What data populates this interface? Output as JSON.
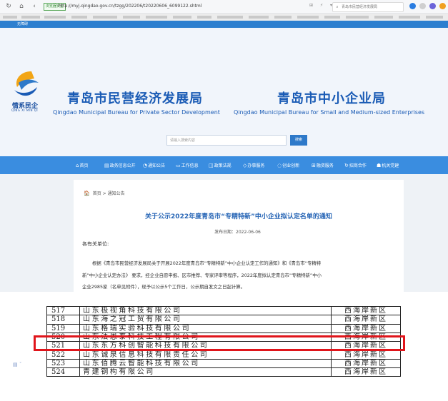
{
  "browser": {
    "security_tag": "浏览器安全",
    "url": "http://myj.qingdao.gov.cn/tzgg/202206/t20220606_6099122.shtml",
    "search_placeholder": "青岛市民营经济发展局"
  },
  "site": {
    "top_link": "无障碍",
    "logo_text": "情系民企",
    "logo_sub": "QING XI MIN QI",
    "title_left_cn": "青岛市民营经济发展局",
    "title_left_en": "Qingdao Municipal Bureau for Private Sector Development",
    "title_right_cn": "青岛市中小企业局",
    "title_right_en": "Qingdao Municipal Bureau for Small and Medium-sized Enterprises",
    "search_placeholder": "请输入搜索内容",
    "search_button": "搜索",
    "nav": [
      {
        "icon": "home-icon",
        "glyph": "⌂",
        "label": "首页"
      },
      {
        "icon": "document-icon",
        "glyph": "▤",
        "label": "政务信息公开"
      },
      {
        "icon": "notice-icon",
        "glyph": "◔",
        "label": "通知公告"
      },
      {
        "icon": "briefcase-icon",
        "glyph": "▭",
        "label": "工作信息"
      },
      {
        "icon": "law-icon",
        "glyph": "◫",
        "label": "政策法规"
      },
      {
        "icon": "service-icon",
        "glyph": "◇",
        "label": "办事服务"
      },
      {
        "icon": "innovation-icon",
        "glyph": "◌",
        "label": "创业创新"
      },
      {
        "icon": "finance-icon",
        "glyph": "⊞",
        "label": "融资服务"
      },
      {
        "icon": "cooperation-icon",
        "glyph": "↻",
        "label": "招商合作"
      },
      {
        "icon": "party-icon",
        "glyph": "☗",
        "label": "机关党建"
      }
    ]
  },
  "article": {
    "breadcrumb_home": "首页",
    "breadcrumb_sep": ">",
    "breadcrumb_current": "通知公告",
    "title": "关于公示2022年度青岛市“专精特新”中小企业拟认定名单的通知",
    "pub_date": "发布日期：2022-06-06",
    "salutation": "各有关单位:",
    "para_lines": [
      "根据《青岛市民营经济发展局关于开展2022年度青岛市“专精特新”中小企业认定工作的通知》和《青岛市“专精特",
      "新”中小企业认定办法》 要求，经企业自愿申报、区市推荐、专家评审等程序，2022年度拟认定青岛市“专精特新”中小",
      "企业2985家（名单见附件），现予以公示5个工作日，公示期自发文之日起计算。"
    ]
  },
  "table_rows": [
    {
      "num": "517",
      "name": "山东极视角科技有限公司",
      "district": "西海岸新区"
    },
    {
      "num": "518",
      "name": "山东海之冠工贸有限公司",
      "district": "西海岸新区"
    },
    {
      "num": "519",
      "name": "山东格瑞实验科技有限公司",
      "district": "西海岸新区"
    },
    {
      "num": "520",
      "name": "山东法恩泰科技工程有限公司",
      "district": "西海岸新区"
    },
    {
      "num": "521",
      "name": "山东东方科创智能科技有限公司",
      "district": "西海岸新区"
    },
    {
      "num": "522",
      "name": "山东诚泉信息科技有限责任公司",
      "district": "西海岸新区"
    },
    {
      "num": "523",
      "name": "山东佰腾云智能科技有限公司",
      "district": "西海岸新区"
    },
    {
      "num": "524",
      "name": "青建钢构有限公司",
      "district": "西海岸新区"
    }
  ],
  "highlighted_row": "520",
  "colors": {
    "accent_blue": "#3a8de0",
    "title_blue": "#1a5bb5",
    "highlight_red": "#e0151b"
  }
}
